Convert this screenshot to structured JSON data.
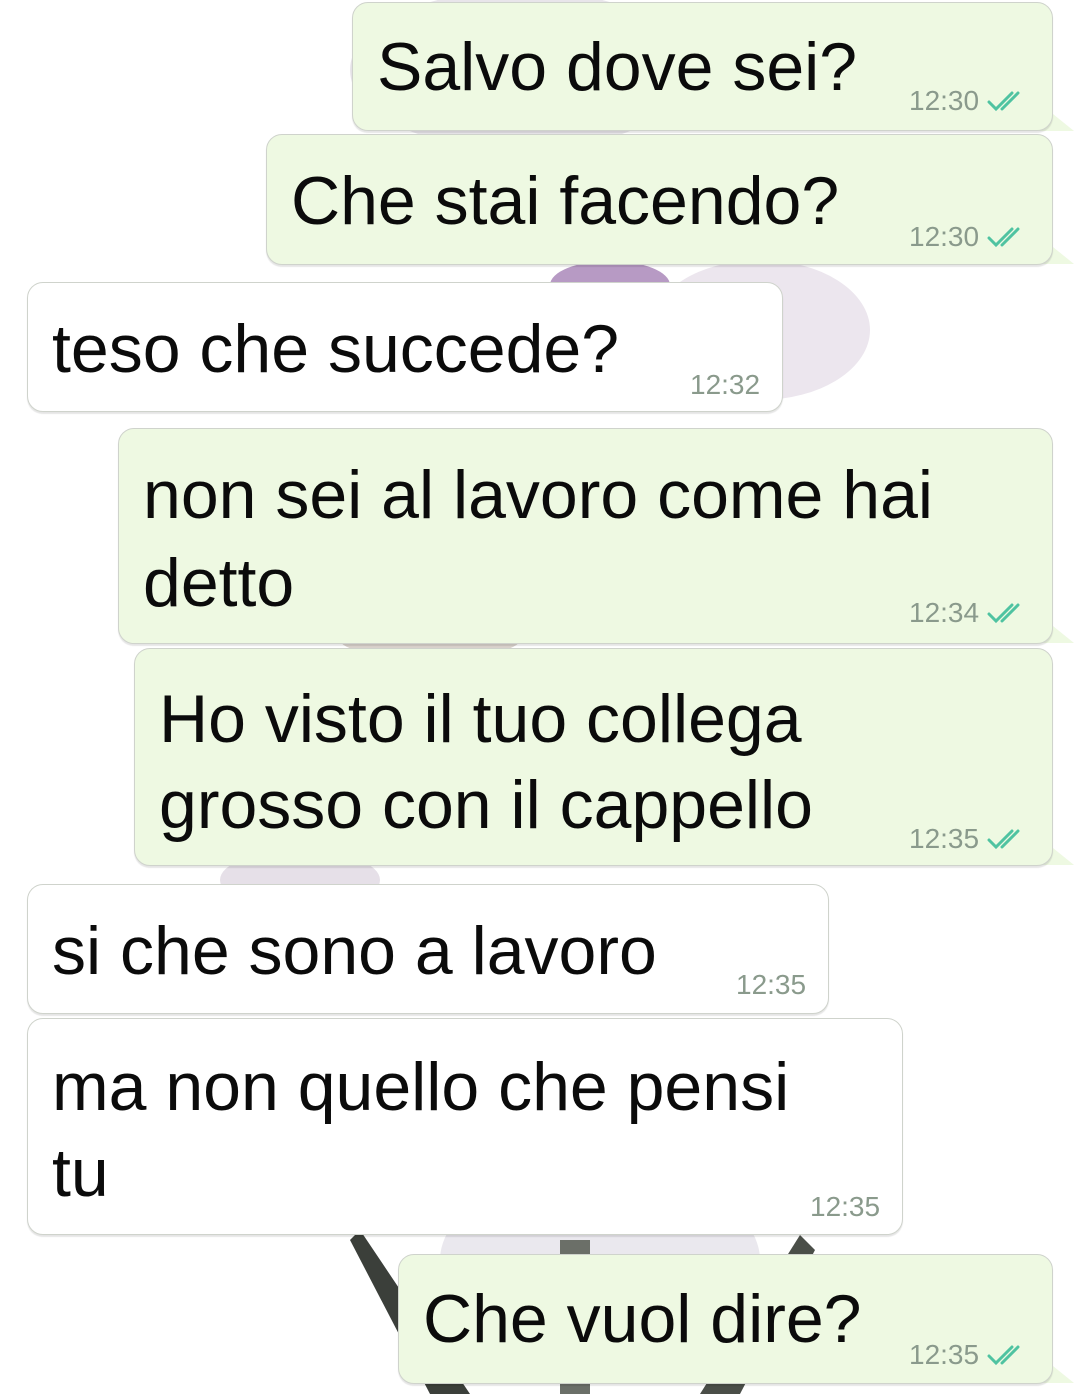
{
  "chat": {
    "read_tick_color": "#4fc3a1",
    "messages": [
      {
        "direction": "out",
        "text": "Salvo dove sei?",
        "time": "12:30",
        "status": "read"
      },
      {
        "direction": "out",
        "text": "Che stai facendo?",
        "time": "12:30",
        "status": "read"
      },
      {
        "direction": "in",
        "text": "teso che succede?",
        "time": "12:32"
      },
      {
        "direction": "out",
        "line1": "non sei al lavoro come hai",
        "line2": "detto",
        "time": "12:34",
        "status": "read"
      },
      {
        "direction": "out",
        "line1": "Ho visto il tuo collega",
        "line2": "grosso con il cappello",
        "time": "12:35",
        "status": "read"
      },
      {
        "direction": "in",
        "text": "si che sono a lavoro",
        "time": "12:35"
      },
      {
        "direction": "in",
        "line1": "ma non quello che pensi",
        "line2": "tu",
        "time": "12:35"
      },
      {
        "direction": "out",
        "text": "Che vuol dire?",
        "time": "12:35",
        "status": "read"
      }
    ]
  }
}
